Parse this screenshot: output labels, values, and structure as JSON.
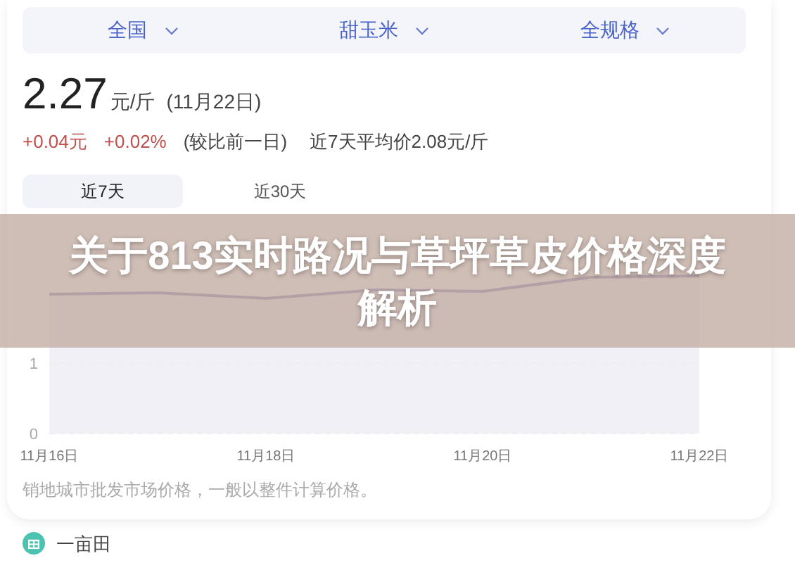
{
  "filters": [
    {
      "label": "全国"
    },
    {
      "label": "甜玉米"
    },
    {
      "label": "全规格"
    }
  ],
  "price": {
    "value": "2.27",
    "unit": "元/斤",
    "date": "(11月22日)"
  },
  "change": {
    "amount": "+0.04元",
    "percent": "+0.02%",
    "basis": "(较比前一日)",
    "average": "近7天平均价2.08元/斤"
  },
  "tabs": [
    {
      "label": "近7天",
      "selected": true
    },
    {
      "label": "近30天",
      "selected": false
    }
  ],
  "chart": {
    "y_labels": [
      "1",
      "0"
    ],
    "x_labels": [
      "11月16日",
      "11月18日",
      "11月20日",
      "11月22日"
    ]
  },
  "note": "销地城市批发市场价格，一般以整件计算价格。",
  "source": {
    "name": "一亩田"
  },
  "banner": {
    "title": "关于813实时路况与草坪草皮价格深度解析"
  }
}
